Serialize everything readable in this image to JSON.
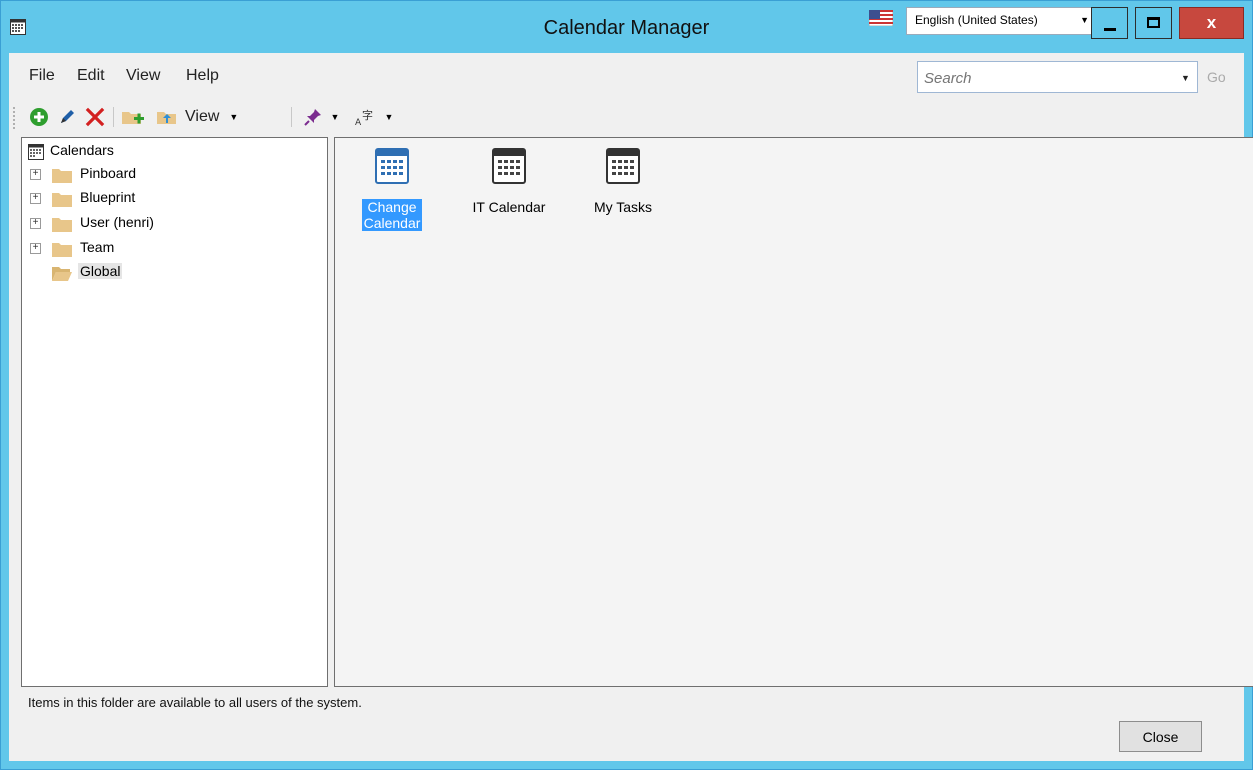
{
  "window": {
    "title": "Calendar Manager",
    "language": "English (United States)",
    "close_glyph": "x"
  },
  "menu": {
    "items": [
      "File",
      "Edit",
      "View",
      "Help"
    ]
  },
  "search": {
    "placeholder": "Search",
    "go_label": "Go"
  },
  "toolbar": {
    "view_label": "View",
    "icons": [
      "add-icon",
      "edit-icon",
      "delete-icon",
      "new-folder-icon",
      "move-folder-icon",
      "pin-icon",
      "language-icon"
    ]
  },
  "tree": {
    "root": "Calendars",
    "folders": [
      {
        "label": "Pinboard",
        "expandable": true
      },
      {
        "label": "Blueprint",
        "expandable": true
      },
      {
        "label": "User (henri)",
        "expandable": true
      },
      {
        "label": "Team",
        "expandable": true
      },
      {
        "label": "Global",
        "expandable": false,
        "selected": true
      }
    ]
  },
  "items": [
    {
      "line1": "Change",
      "line2": "Calendar",
      "selected": true
    },
    {
      "line1": "IT Calendar",
      "line2": "",
      "selected": false
    },
    {
      "line1": "My Tasks",
      "line2": "",
      "selected": false
    }
  ],
  "status_text": "Items in this folder are available to all users of the system.",
  "close_button": "Close",
  "colors": {
    "titlebar": "#61c7ea",
    "close": "#c7483e",
    "selection": "#3399ff",
    "add_green": "#2e9e2e",
    "delete_red": "#d32020",
    "pin_purple": "#7b2c8f",
    "folder": "#e8c68a"
  }
}
